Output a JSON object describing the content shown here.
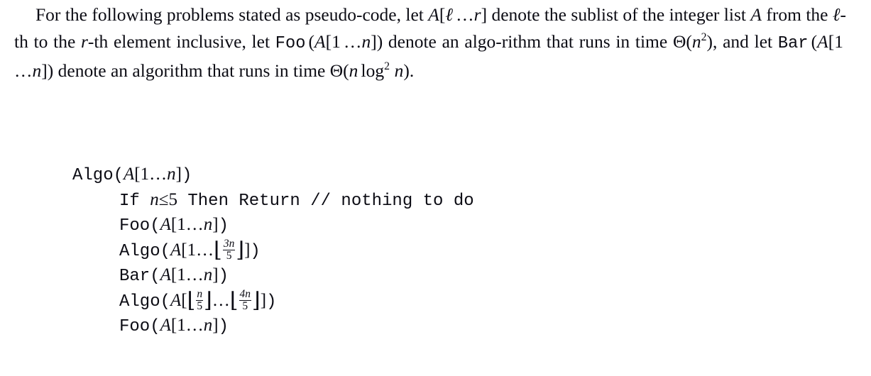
{
  "document": {
    "type": "textbook-problem-statement",
    "background_color": "#ffffff",
    "text_color": "#0c0c14"
  },
  "paragraph": {
    "s1": "For the following problems stated as pseudo-code, let",
    "m1_A": "A",
    "m1_lb": "[",
    "m1_l": "ℓ",
    "m1_dots": "…",
    "m1_r": "r",
    "m1_rb": "]",
    "s2": "denote the sublist of the integer list",
    "m2_A": "A",
    "s3": "from the",
    "m3_l": "ℓ",
    "s4": "-th to the",
    "m4_r": "r",
    "s5": "-th element inclusive, let",
    "foo_name": "Foo",
    "foo_open": "(",
    "foo_A": "A",
    "foo_lb": "[",
    "foo_one": "1",
    "foo_dots": "…",
    "foo_n": "n",
    "foo_rb": "]",
    "foo_close": ")",
    "s6": "denote an algo-",
    "s7": "rithm that runs in time",
    "theta1_sym": "Θ(",
    "theta1_n": "n",
    "theta1_exp": "2",
    "theta1_close": "),",
    "s8": "and let",
    "bar_name": "Bar",
    "bar_open": "(",
    "bar_A": "A",
    "bar_lb": "[",
    "bar_one": "1",
    "bar_dots": "…",
    "bar_n": "n",
    "bar_rb": "]",
    "bar_close": ")",
    "s9": "denote an algorithm that runs in time",
    "theta2_open": "Θ(",
    "theta2_n": "n",
    "theta2_log": "log",
    "theta2_exp": "2",
    "theta2_n2": "n",
    "theta2_close": ")."
  },
  "pseudocode": {
    "lines": [
      {
        "indent": 0,
        "call": "Algo",
        "text": "Algo(A[1…n])"
      },
      {
        "indent": 1,
        "keyword_if": "If",
        "var_n": "n",
        "op_le": "≤",
        "num_5": "5",
        "keyword_then": "Then",
        "keyword_return": "Return",
        "comment": "// nothing to do",
        "text": "If n≤5 Then Return // nothing to do"
      },
      {
        "indent": 1,
        "call": "Foo",
        "text": "Foo(A[1…n])"
      },
      {
        "indent": 1,
        "call": "Algo",
        "text": "Algo(A[1…⌊3n/5⌋])",
        "frac_num": "3n",
        "frac_den": "5"
      },
      {
        "indent": 1,
        "call": "Bar",
        "text": "Bar(A[1…n])"
      },
      {
        "indent": 1,
        "call": "Algo",
        "text": "Algo(A[⌊n/5⌋…⌊4n/5⌋])",
        "frac1_num": "n",
        "frac1_den": "5",
        "frac2_num": "4n",
        "frac2_den": "5"
      },
      {
        "indent": 1,
        "call": "Foo",
        "text": "Foo(A[1…n])"
      }
    ],
    "tokens": {
      "algo": "Algo",
      "foo": "Foo",
      "bar": "Bar",
      "if": "If",
      "then": "Then",
      "return": "Return",
      "comment": "// nothing to do",
      "paren_open": "(",
      "paren_close": ")",
      "bracket_open": "[",
      "bracket_close": "]",
      "floor_open": "⌊",
      "floor_close": "⌋",
      "ellipsis": "…",
      "A": "A",
      "n": "n",
      "one": "1",
      "five": "5",
      "le": "≤",
      "three_n": "3n",
      "four_n": "4n"
    }
  }
}
